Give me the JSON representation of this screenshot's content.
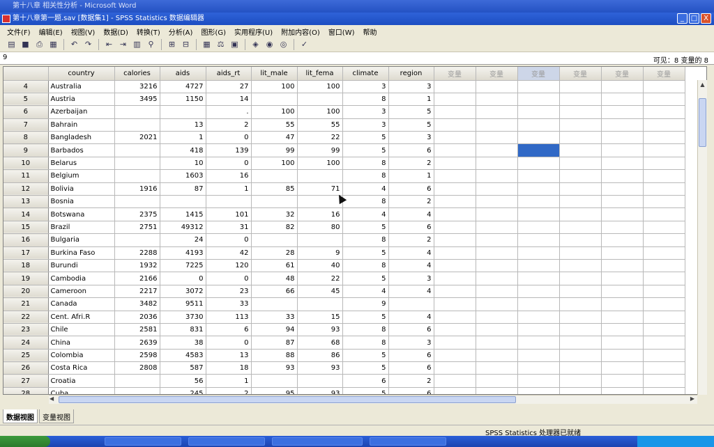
{
  "window": {
    "title": "第十八章第一题.sav [数据集1] - SPSS Statistics 数据编辑器",
    "background_title": "第十八章 相关性分析 - Microsoft Word",
    "minimize": "_",
    "maximize": "□",
    "close": "X"
  },
  "menu": [
    "文件(F)",
    "编辑(E)",
    "视图(V)",
    "数据(D)",
    "转换(T)",
    "分析(A)",
    "图形(G)",
    "实用程序(U)",
    "附加内容(O)",
    "窗口(W)",
    "帮助"
  ],
  "cellbar": {
    "cell_ref": "9",
    "visible": "可见：8 变量的 8"
  },
  "columns": [
    "country",
    "calories",
    "aids",
    "aids_rt",
    "lit_male",
    "lit_fema",
    "climate",
    "region",
    "变量",
    "变量",
    "变量",
    "变量",
    "变量",
    "变量"
  ],
  "rows": [
    [
      "4",
      "Australia",
      "3216",
      "4727",
      "27",
      "100",
      "100",
      "3",
      "3"
    ],
    [
      "5",
      "Austria",
      "3495",
      "1150",
      "14",
      "",
      "",
      "8",
      "1"
    ],
    [
      "6",
      "Azerbaijan",
      "",
      "",
      ".",
      "100",
      "100",
      "3",
      "5"
    ],
    [
      "7",
      "Bahrain",
      "",
      "13",
      "2",
      "55",
      "55",
      "3",
      "5"
    ],
    [
      "8",
      "Bangladesh",
      "2021",
      "1",
      "0",
      "47",
      "22",
      "5",
      "3"
    ],
    [
      "9",
      "Barbados",
      "",
      "418",
      "139",
      "99",
      "99",
      "5",
      "6"
    ],
    [
      "10",
      "Belarus",
      "",
      "10",
      "0",
      "100",
      "100",
      "8",
      "2"
    ],
    [
      "11",
      "Belgium",
      "",
      "1603",
      "16",
      "",
      "",
      "8",
      "1"
    ],
    [
      "12",
      "Bolivia",
      "1916",
      "87",
      "1",
      "85",
      "71",
      "4",
      "6"
    ],
    [
      "13",
      "Bosnia",
      "",
      "",
      "",
      "",
      "",
      "8",
      "2"
    ],
    [
      "14",
      "Botswana",
      "2375",
      "1415",
      "101",
      "32",
      "16",
      "4",
      "4"
    ],
    [
      "15",
      "Brazil",
      "2751",
      "49312",
      "31",
      "82",
      "80",
      "5",
      "6"
    ],
    [
      "16",
      "Bulgaria",
      "",
      "24",
      "0",
      "",
      "",
      "8",
      "2"
    ],
    [
      "17",
      "Burkina Faso",
      "2288",
      "4193",
      "42",
      "28",
      "9",
      "5",
      "4"
    ],
    [
      "18",
      "Burundi",
      "1932",
      "7225",
      "120",
      "61",
      "40",
      "8",
      "4"
    ],
    [
      "19",
      "Cambodia",
      "2166",
      "0",
      "0",
      "48",
      "22",
      "5",
      "3"
    ],
    [
      "20",
      "Cameroon",
      "2217",
      "3072",
      "23",
      "66",
      "45",
      "4",
      "4"
    ],
    [
      "21",
      "Canada",
      "3482",
      "9511",
      "33",
      "",
      "",
      "9",
      ""
    ],
    [
      "22",
      "Cent. Afri.R",
      "2036",
      "3730",
      "113",
      "33",
      "15",
      "5",
      "4"
    ],
    [
      "23",
      "Chile",
      "2581",
      "831",
      "6",
      "94",
      "93",
      "8",
      "6"
    ],
    [
      "24",
      "China",
      "2639",
      "38",
      "0",
      "87",
      "68",
      "8",
      "3"
    ],
    [
      "25",
      "Colombia",
      "2598",
      "4583",
      "13",
      "88",
      "86",
      "5",
      "6"
    ],
    [
      "26",
      "Costa Rica",
      "2808",
      "587",
      "18",
      "93",
      "93",
      "5",
      "6"
    ],
    [
      "27",
      "Croatia",
      "",
      "56",
      "1",
      "",
      "",
      "6",
      "2"
    ],
    [
      "28",
      "Cuba",
      "",
      "245",
      "2",
      "95",
      "93",
      "5",
      "6"
    ]
  ],
  "tabs": [
    "数据视图",
    "变量视图"
  ],
  "status": "SPSS Statistics  处理器已就绪",
  "colors": {
    "selection": "#3169c6",
    "titlebar": "#2452c3"
  }
}
